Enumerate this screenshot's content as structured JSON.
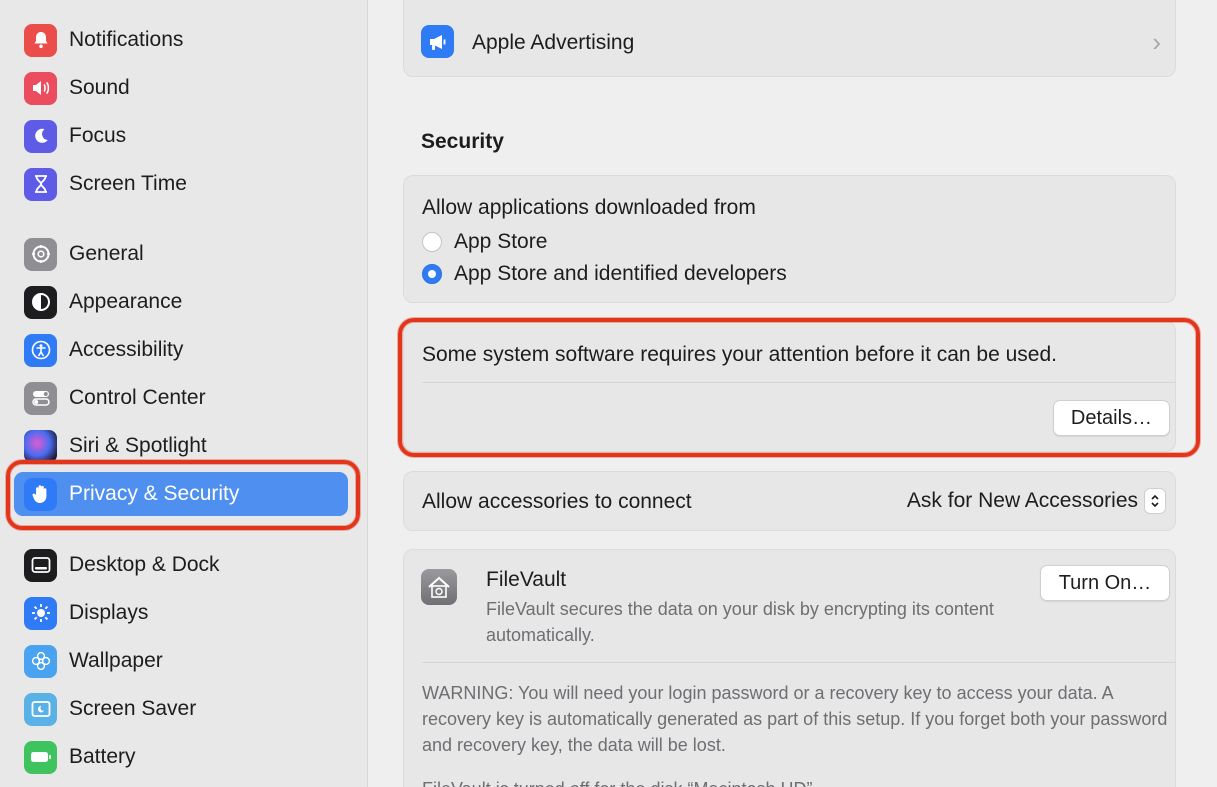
{
  "sidebar": {
    "items": [
      {
        "label": "Notifications",
        "icon": "bell-icon",
        "color": "#eb4d4b"
      },
      {
        "label": "Sound",
        "icon": "speaker-icon",
        "color": "#eb4d5e"
      },
      {
        "label": "Focus",
        "icon": "moon-icon",
        "color": "#5e5ce6"
      },
      {
        "label": "Screen Time",
        "icon": "hourglass-icon",
        "color": "#5e5ce6"
      },
      {
        "label": "General",
        "icon": "gear-icon",
        "color": "#8e8e93"
      },
      {
        "label": "Appearance",
        "icon": "appearance-icon",
        "color": "#1d1d1f"
      },
      {
        "label": "Accessibility",
        "icon": "accessibility-icon",
        "color": "#2f7bf5"
      },
      {
        "label": "Control Center",
        "icon": "toggles-icon",
        "color": "#8e8e93"
      },
      {
        "label": "Siri & Spotlight",
        "icon": "siri-icon",
        "color": "#3b3b6e"
      },
      {
        "label": "Privacy & Security",
        "icon": "hand-icon",
        "color": "#2f7bf5",
        "selected": true
      },
      {
        "label": "Desktop & Dock",
        "icon": "dock-icon",
        "color": "#1d1d1f"
      },
      {
        "label": "Displays",
        "icon": "sun-icon",
        "color": "#2f7bf5"
      },
      {
        "label": "Wallpaper",
        "icon": "flower-icon",
        "color": "#4aa3f0"
      },
      {
        "label": "Screen Saver",
        "icon": "screensaver-icon",
        "color": "#5ab1e6"
      },
      {
        "label": "Battery",
        "icon": "battery-icon",
        "color": "#3fc35e"
      }
    ]
  },
  "main": {
    "advertising": {
      "label": "Apple Advertising",
      "icon": "megaphone-icon",
      "chevron": "›"
    },
    "security": {
      "title": "Security",
      "allow_label": "Allow applications downloaded from",
      "options": [
        "App Store",
        "App Store and identified developers"
      ],
      "selected_option": "App Store and identified developers"
    },
    "attention": {
      "message": "Some system software requires your attention before it can be used.",
      "details_button": "Details…"
    },
    "accessories": {
      "label": "Allow accessories to connect",
      "value": "Ask for New Accessories"
    },
    "filevault": {
      "title": "FileVault",
      "description": "FileVault secures the data on your disk by encrypting its content automatically.",
      "button": "Turn On…",
      "warning": "WARNING: You will need your login password or a recovery key to access your data. A recovery key is automatically generated as part of this setup. If you forget both your password and recovery key, the data will be lost.",
      "status": "FileVault is turned off for the disk “Macintosh HD”."
    }
  },
  "colors": {
    "accent": "#2f7bf5",
    "selection": "#4f8ff0",
    "highlight_ring": "#e2361c"
  }
}
